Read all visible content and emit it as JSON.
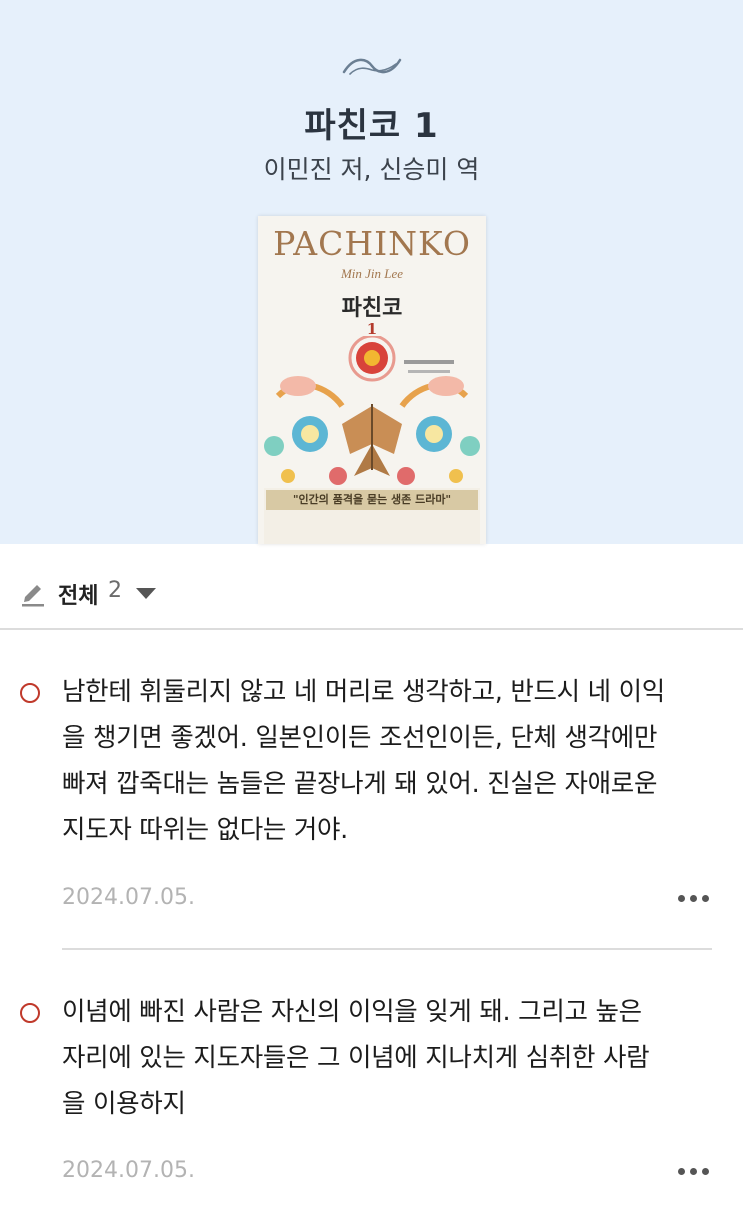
{
  "book": {
    "title": "파친코 1",
    "author": "이민진 저, 신승미 역"
  },
  "cover": {
    "title_en": "PACHINKO",
    "author_en": "Min Jin Lee",
    "title_ko": "파친코",
    "volume": "1",
    "tagline": "\"인간의 품격을 묻는 생존 드라마\""
  },
  "filter": {
    "label": "전체",
    "count": "2"
  },
  "posts": [
    {
      "text": "남한테 휘둘리지 않고 네 머리로 생각하고, 반드시 네 이익\n을 챙기면 좋겠어. 일본인이든 조선인이든, 단체 생각에만\n빠져 깝죽대는 놈들은 끝장나게 돼 있어. 진실은 자애로운\n지도자 따위는 없다는 거야.",
      "date": "2024.07.05."
    },
    {
      "text": "이념에 빠진 사람은 자신의 이익을 잊게 돼. 그리고 높은\n자리에 있는 지도자들은 그 이념에 지나치게 심취한 사람\n을 이용하지",
      "date": "2024.07.05."
    }
  ],
  "colors": {
    "hero_bg": "#e6f0fb",
    "bullet": "#c0392b",
    "date": "#b3b3b3"
  },
  "icons": [
    "ornament-icon",
    "pencil-icon",
    "caret-down-icon",
    "more-icon",
    "circle-bullet-icon"
  ]
}
